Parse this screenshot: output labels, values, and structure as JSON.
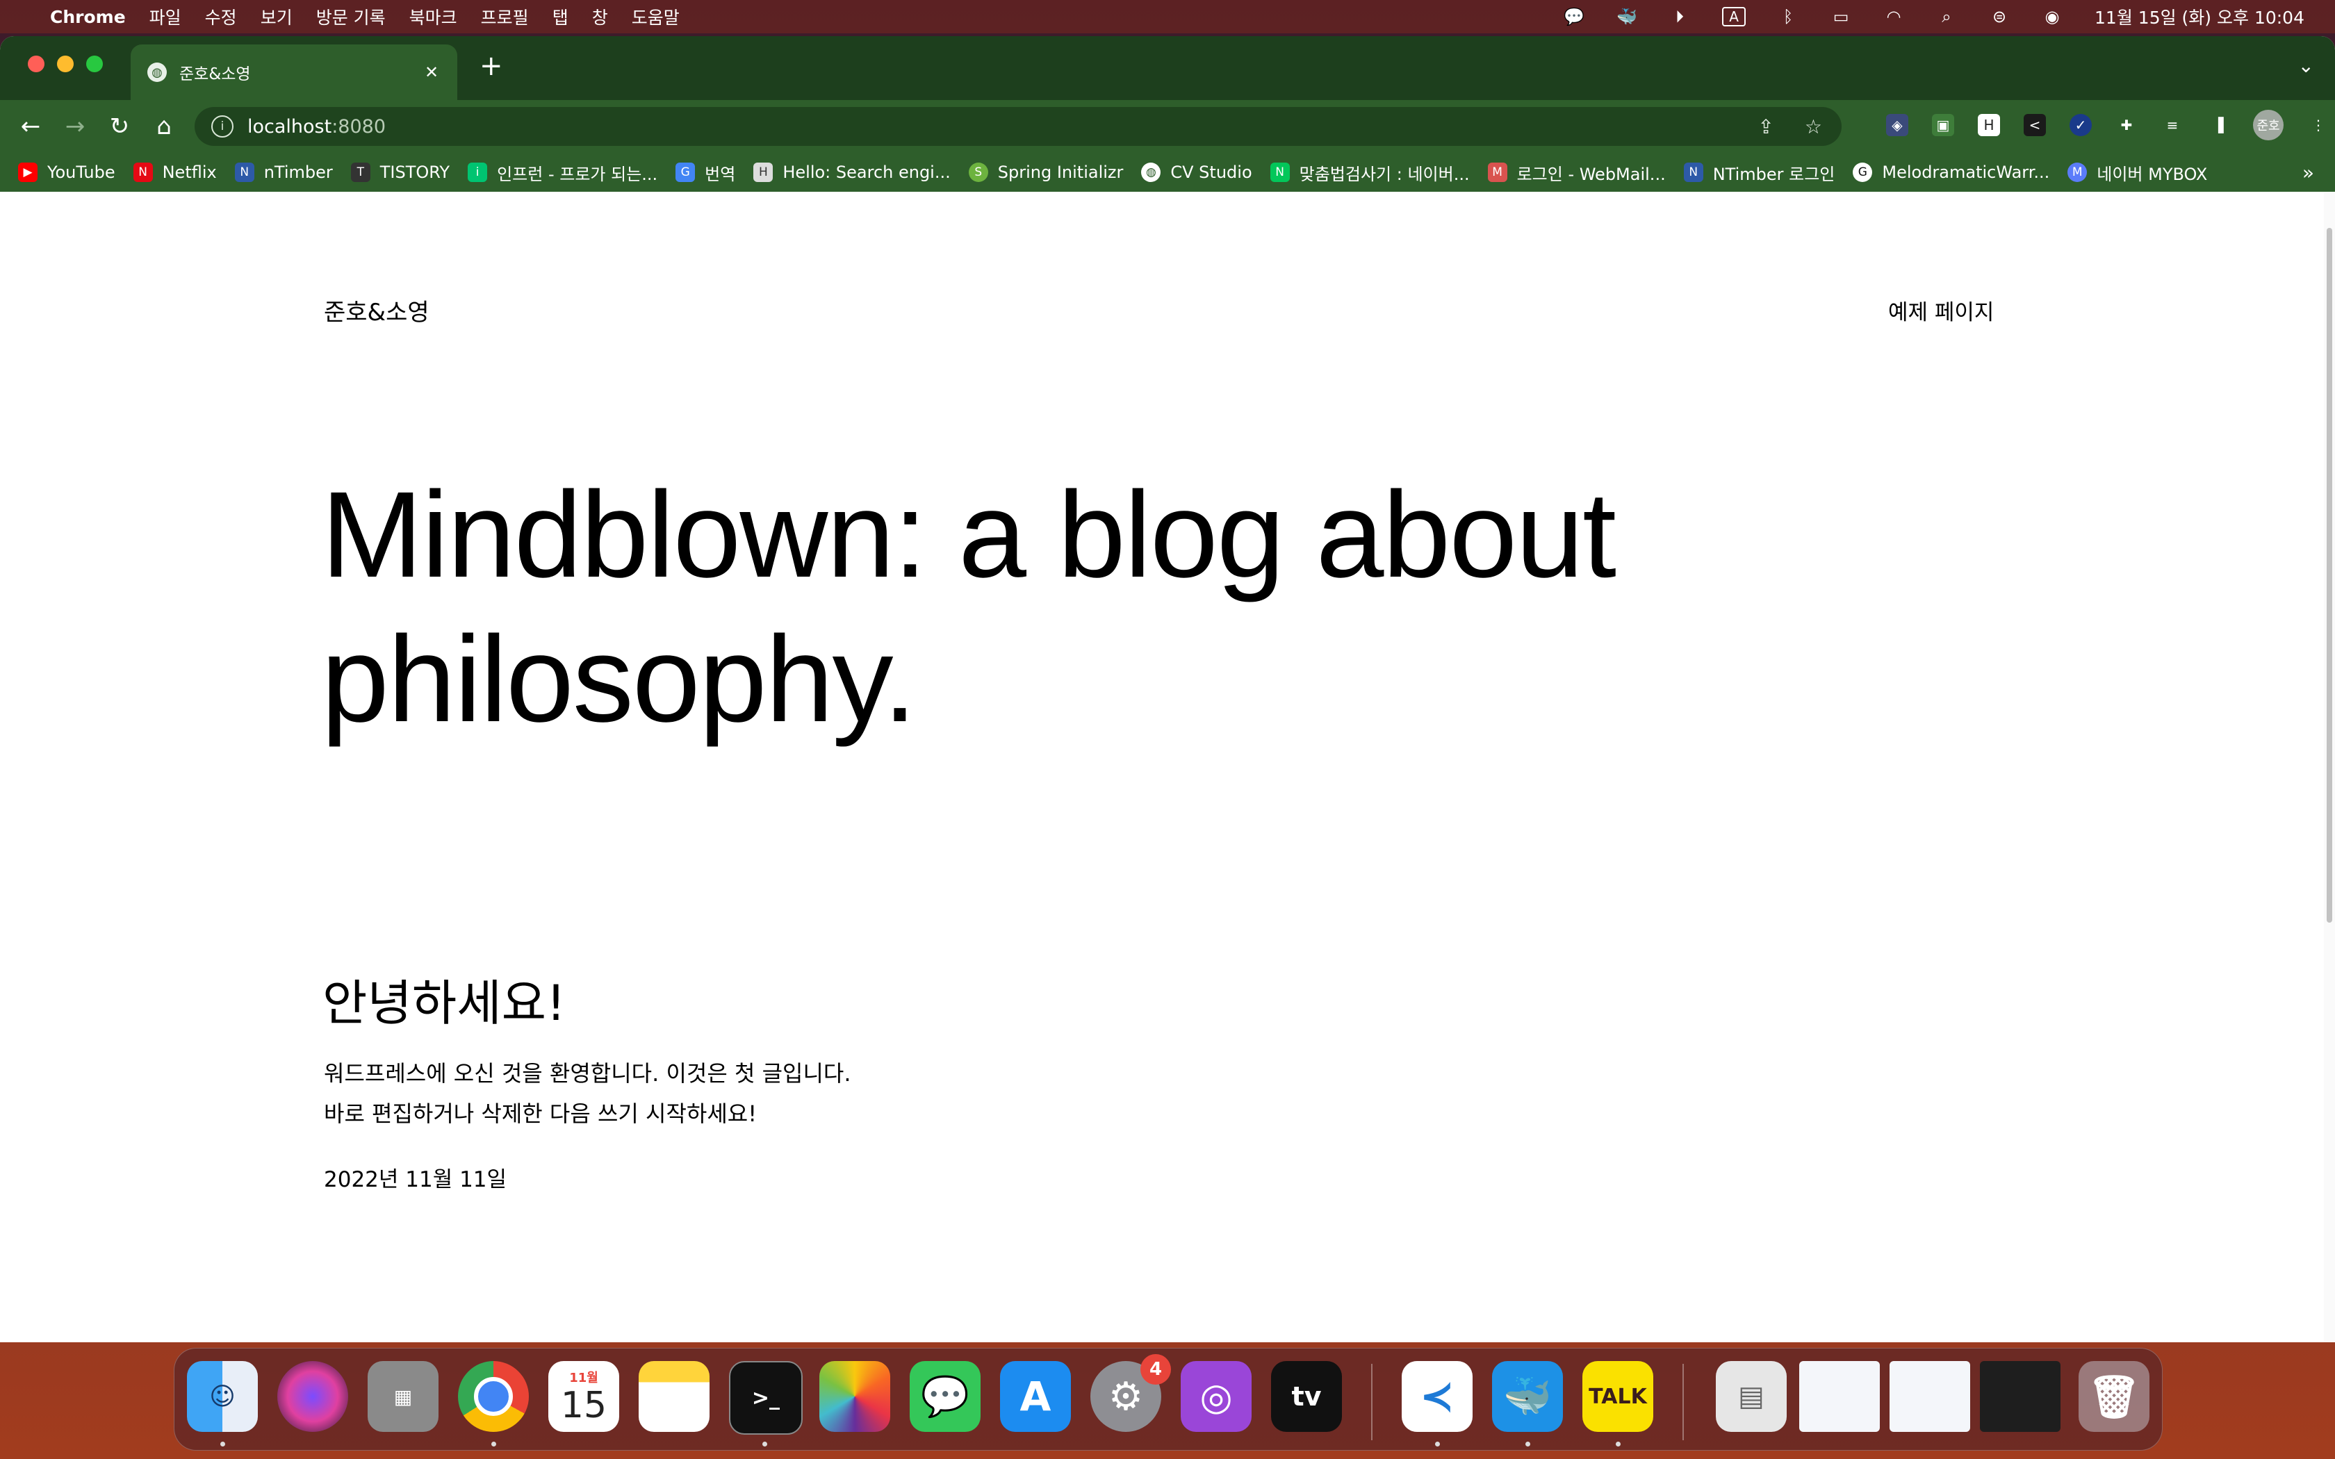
{
  "menubar": {
    "app_name": "Chrome",
    "menus": [
      "파일",
      "수정",
      "보기",
      "방문 기록",
      "북마크",
      "프로필",
      "탭",
      "창",
      "도움말"
    ],
    "status_icons": [
      "notification-icon",
      "docker-icon",
      "play-icon",
      "input-source-icon",
      "bluetooth-icon",
      "battery-icon",
      "wifi-icon",
      "spotlight-icon",
      "control-center-icon",
      "siri-icon"
    ],
    "input_source": "A",
    "clock": "11월 15일 (화) 오후 10:04"
  },
  "browser": {
    "tab_title": "준호&소영",
    "url_host": "localhost",
    "url_port": ":8080",
    "profile": "준호",
    "bookmarks": [
      {
        "label": "YouTube",
        "color": "#ff0000",
        "glyph": "▶"
      },
      {
        "label": "Netflix",
        "color": "#e50914",
        "glyph": "N"
      },
      {
        "label": "nTimber",
        "color": "#2d5aa8",
        "glyph": "N"
      },
      {
        "label": "TISTORY",
        "color": "#333333",
        "glyph": "T"
      },
      {
        "label": "인프런 - 프로가 되는...",
        "color": "#00c471",
        "glyph": "i"
      },
      {
        "label": "번역",
        "color": "#4285f4",
        "glyph": "G"
      },
      {
        "label": "Hello: Search engi...",
        "color": "#dddddd",
        "glyph": "H"
      },
      {
        "label": "Spring Initializr",
        "color": "#6db33f",
        "glyph": "S"
      },
      {
        "label": "CV Studio",
        "color": "#ffffff",
        "glyph": "C"
      },
      {
        "label": "맞춤법검사기 : 네이버...",
        "color": "#03c75a",
        "glyph": "N"
      },
      {
        "label": "로그인 - WebMail...",
        "color": "#d9534f",
        "glyph": "M"
      },
      {
        "label": "NTimber 로그인",
        "color": "#2d5aa8",
        "glyph": "N"
      },
      {
        "label": "MelodramaticWarr...",
        "color": "#ffffff",
        "glyph": "G"
      },
      {
        "label": "네이버 MYBOX",
        "color": "#5b7cfa",
        "glyph": "M"
      }
    ],
    "more": "»"
  },
  "page": {
    "site_title": "준호&소영",
    "nav_link": "예제 페이지",
    "hero": "Mindblown: a blog about philosophy.",
    "post_title": "안녕하세요!",
    "post_body": "워드프레스에 오신 것을 환영합니다. 이것은 첫 글입니다. 바로 편집하거나 삭제한 다음 쓰기 시작하세요!",
    "post_date": "2022년 11월 11일"
  },
  "dock": {
    "calendar_month": "11월",
    "calendar_day": "15",
    "settings_badge": "4",
    "tv_label": "tv",
    "talk_label": "TALK",
    "terminal_label": ">_"
  }
}
